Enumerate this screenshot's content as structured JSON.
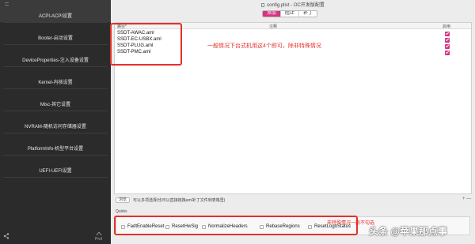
{
  "window": {
    "title": "config.plist - OC开发版配置"
  },
  "sidebar": {
    "items": [
      {
        "label": "ACPI-ACPI设置",
        "active": true
      },
      {
        "label": "Booter-启动设置"
      },
      {
        "label": "DeviceProperties-注入设备设置"
      },
      {
        "label": "Kernel-内核设置"
      },
      {
        "label": "Misc-其它设置"
      },
      {
        "label": "NVRAM-随机访问存储器设置"
      },
      {
        "label": "PlatformInfo-机型平台设置"
      },
      {
        "label": "UEFI-UEFI设置"
      }
    ],
    "bottom_left_icon": "share-icon",
    "bottom_right_icon": "export-icon",
    "bottom_right_text": "ProI"
  },
  "tabs": {
    "items": [
      "添加",
      "阻止",
      "补丁"
    ],
    "selected": "添加"
  },
  "table": {
    "columns": {
      "path": "路径*",
      "comment": "注释",
      "enabled": "启用"
    },
    "rows": [
      {
        "path": "SSDT-AWAC.aml",
        "comment": "",
        "enabled": true
      },
      {
        "path": "SSDT-EC-USBX.aml",
        "comment": "",
        "enabled": true
      },
      {
        "path": "SSDT-PLUG.aml",
        "comment": "",
        "enabled": true
      },
      {
        "path": "SSDT-PMC.aml",
        "comment": "",
        "enabled": true
      }
    ],
    "accent_color": "#d63384"
  },
  "annotations": {
    "table_note": "一般情况下台式机用这4个即可，除非特殊情况",
    "quirks_note": "非特殊情况一般不勾选",
    "color": "#e4312b"
  },
  "toolbar": {
    "browse_label": "浏览",
    "hint": "可以多项选择(也可以直接拖拽aml补丁文件到表格里)",
    "add_remove": "+ —"
  },
  "quirks": {
    "label": "Quirks",
    "options": [
      {
        "label": "FadtEnableReset",
        "checked": false
      },
      {
        "label": "ResetHwSig",
        "checked": false
      },
      {
        "label": "NormalizeHeaders",
        "checked": false
      },
      {
        "label": "RebaseRegions",
        "checked": false
      },
      {
        "label": "ResetLogoStatus",
        "checked": false
      }
    ]
  },
  "watermark": "头条 @苹果那点事"
}
